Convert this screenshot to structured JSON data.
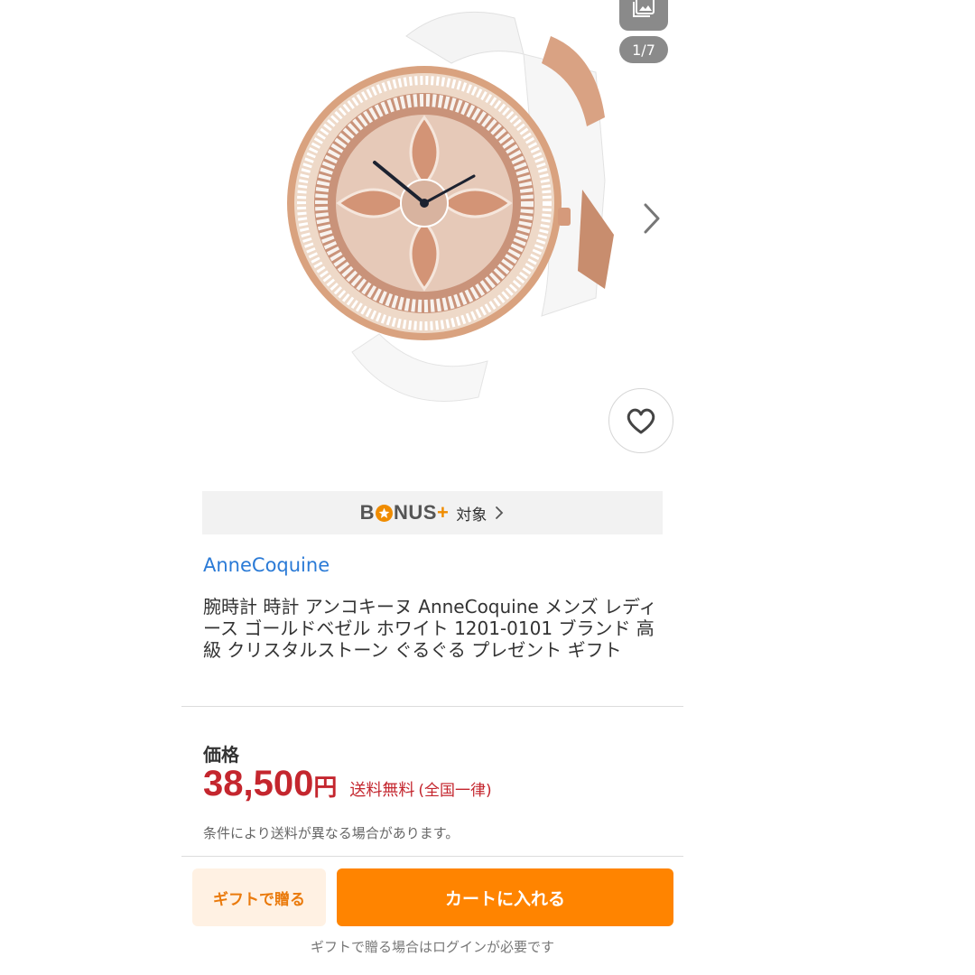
{
  "gallery": {
    "counter": "1/7",
    "photo_icon": "image-icon",
    "next_icon": "chevron-right-icon",
    "favorite_icon": "heart-outline-icon"
  },
  "bonus": {
    "logo_text_before": "B",
    "logo_text_after": "NUS",
    "logo_plus": "+",
    "label": "対象",
    "chevron": "›",
    "accent_color": "#f08c00"
  },
  "shop": {
    "name": "AnneCoquine"
  },
  "product": {
    "title": "腕時計 時計 アンコキーヌ AnneCoquine メンズ レディース ゴールドベゼル ホワイト 1201-0101 ブランド 高級 クリスタルストーン ぐるぐる プレゼント ギフト"
  },
  "price": {
    "label": "価格",
    "value": "38,500",
    "currency": "円",
    "shipping_free": "送料無料",
    "shipping_scope": "(全国一律)",
    "note": "条件により送料が異なる場合があります。",
    "color": "#c4262e"
  },
  "actions": {
    "gift_label": "ギフトで贈る",
    "cart_label": "カートに入れる",
    "login_note": "ギフトで贈る場合はログインが必要です",
    "cart_color": "#ff8400"
  }
}
